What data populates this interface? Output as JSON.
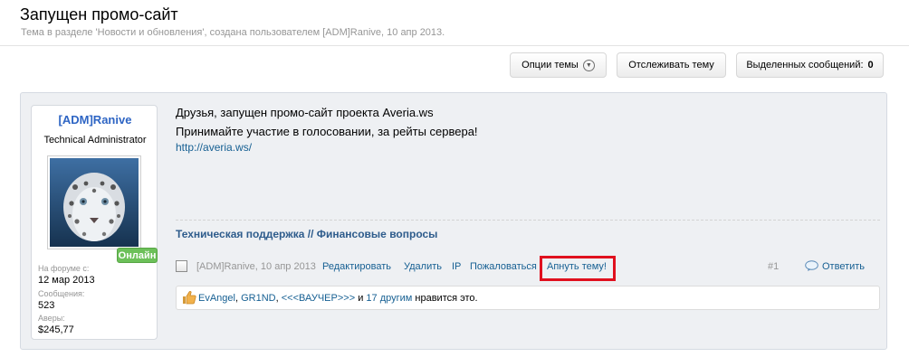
{
  "thread": {
    "title": "Запущен промо-сайт",
    "description": "Тема в разделе 'Новости и обновления', создана пользователем [ADM]Ranive, 10 апр 2013."
  },
  "toolbar": {
    "options_label": "Опции темы",
    "watch_label": "Отслеживать тему",
    "selected_label": "Выделенных сообщений:",
    "selected_count": "0"
  },
  "author": {
    "name": "[ADM]Ranive",
    "title": "Technical Administrator",
    "status": "Онлайн",
    "joined_label": "На форуме с:",
    "joined_value": "12 мар 2013",
    "messages_label": "Сообщения:",
    "messages_value": "523",
    "averies_label": "Аверы:",
    "averies_value": "$245,77"
  },
  "post": {
    "line1": "Друзья, запущен промо-сайт проекта Averia.ws",
    "line2": "Принимайте участие в голосовании, за рейты сервера!",
    "link": "http://averia.ws/",
    "prefix1": "Техническая поддержка",
    "prefix_sep": "//",
    "prefix2": "Финансовые вопросы",
    "meta_author": "[ADM]Ranive, 10 апр 2013",
    "edit": "Редактировать",
    "delete": "Удалить",
    "ip": "IP",
    "report": "Пожаловаться",
    "bump": "Апнуть тему!",
    "number": "#1",
    "reply": "Ответить"
  },
  "likes": {
    "user1": "EvAngel",
    "sep1": ",",
    "user2": "GR1ND",
    "sep2": ",",
    "user3": "<<<ВАУЧЕР>>>",
    "and": "и",
    "others": "17 другим",
    "suffix": "нравится это."
  },
  "colors": {
    "accent": "#176093",
    "online": "#6cc059",
    "highlight_box": "#e0101e"
  }
}
